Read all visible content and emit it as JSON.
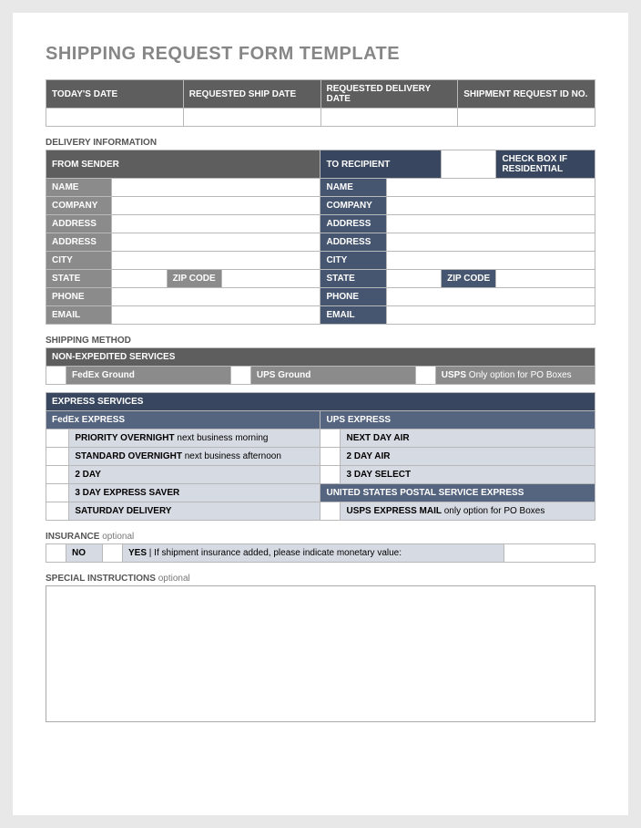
{
  "title": "SHIPPING REQUEST FORM TEMPLATE",
  "topHeaders": {
    "todaysDate": "TODAY'S DATE",
    "reqShipDate": "REQUESTED SHIP DATE",
    "reqDeliveryDate": "REQUESTED DELIVERY DATE",
    "shipmentId": "SHIPMENT REQUEST ID NO."
  },
  "sections": {
    "deliveryInfo": "DELIVERY INFORMATION",
    "fromSender": "FROM SENDER",
    "toRecipient": "TO RECIPIENT",
    "checkResidential": "CHECK BOX IF RESIDENTIAL",
    "shippingMethod": "SHIPPING METHOD",
    "nonExpedited": "NON-EXPEDITED SERVICES",
    "expressServices": "EXPRESS SERVICES",
    "fedexExpress": "FedEx EXPRESS",
    "upsExpress": "UPS EXPRESS",
    "uspsExpress": "UNITED STATES POSTAL SERVICE EXPRESS",
    "insurance": "INSURANCE",
    "insuranceOpt": "optional",
    "specialInstr": "SPECIAL INSTRUCTIONS",
    "specialInstrOpt": "optional"
  },
  "fields": {
    "name": "NAME",
    "company": "COMPANY",
    "address": "ADDRESS",
    "city": "CITY",
    "state": "STATE",
    "zip": "ZIP CODE",
    "phone": "PHONE",
    "email": "EMAIL"
  },
  "nonExpedited": {
    "fedexGround": "FedEx Ground",
    "upsGround": "UPS Ground",
    "usps": "USPS",
    "uspsNote": " Only option for PO Boxes"
  },
  "fedexOptions": {
    "priorityOvernight": "PRIORITY OVERNIGHT",
    "priorityOvernightNote": " next business morning",
    "standardOvernight": "STANDARD OVERNIGHT",
    "standardOvernightNote": " next business afternoon",
    "twoDay": "2 DAY",
    "threeDaySaver": "3 DAY EXPRESS SAVER",
    "saturday": "SATURDAY DELIVERY"
  },
  "upsOptions": {
    "nextDay": "NEXT DAY AIR",
    "twoDay": "2 DAY AIR",
    "threeDay": "3 DAY SELECT"
  },
  "uspsOptions": {
    "expressMail": "USPS EXPRESS MAIL",
    "expressMailNote": " only option for PO Boxes"
  },
  "insurance": {
    "no": "NO",
    "yes": "YES",
    "sep": "   |   ",
    "prompt": "If shipment insurance added, please indicate monetary value:"
  }
}
